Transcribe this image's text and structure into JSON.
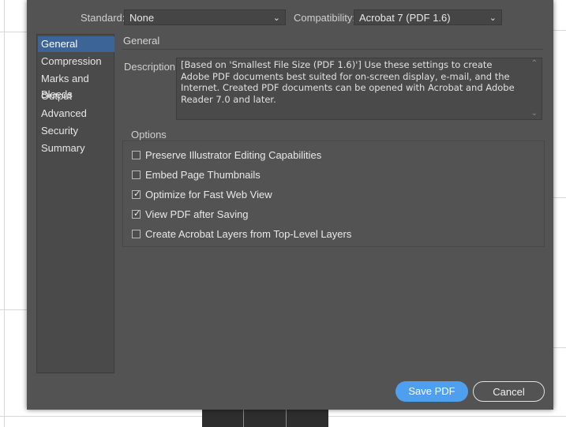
{
  "header": {
    "standard_label": "Standard:",
    "standard_value": "None",
    "compatibility_label": "Compatibility:",
    "compatibility_value": "Acrobat 7 (PDF 1.6)"
  },
  "sidebar": {
    "items": [
      {
        "label": "General",
        "active": true
      },
      {
        "label": "Compression",
        "active": false
      },
      {
        "label": "Marks and Bleeds",
        "active": false
      },
      {
        "label": "Output",
        "active": false
      },
      {
        "label": "Advanced",
        "active": false
      },
      {
        "label": "Security",
        "active": false
      },
      {
        "label": "Summary",
        "active": false
      }
    ]
  },
  "main": {
    "section_title": "General",
    "description_label": "Description:",
    "description_text": "[Based on 'Smallest File Size (PDF 1.6)'] Use these settings to create Adobe PDF documents best suited for on-screen display, e-mail, and the Internet. Created PDF documents can be opened with Acrobat and Adobe Reader 7.0 and later.",
    "options_title": "Options",
    "options": [
      {
        "label": "Preserve Illustrator Editing Capabilities",
        "checked": false
      },
      {
        "label": "Embed Page Thumbnails",
        "checked": false
      },
      {
        "label": "Optimize for Fast Web View",
        "checked": true
      },
      {
        "label": "View PDF after Saving",
        "checked": true
      },
      {
        "label": "Create Acrobat Layers from Top-Level Layers",
        "checked": false
      }
    ]
  },
  "footer": {
    "save_label": "Save PDF",
    "cancel_label": "Cancel"
  },
  "colors": {
    "dialog_bg": "#535353",
    "accent": "#4ea0ef",
    "selection": "#3d6497"
  },
  "icons": {
    "dropdown": "chevron-down-icon",
    "checkbox_checked": "checkmark-icon",
    "scroll": "scroll-arrow-icon"
  }
}
